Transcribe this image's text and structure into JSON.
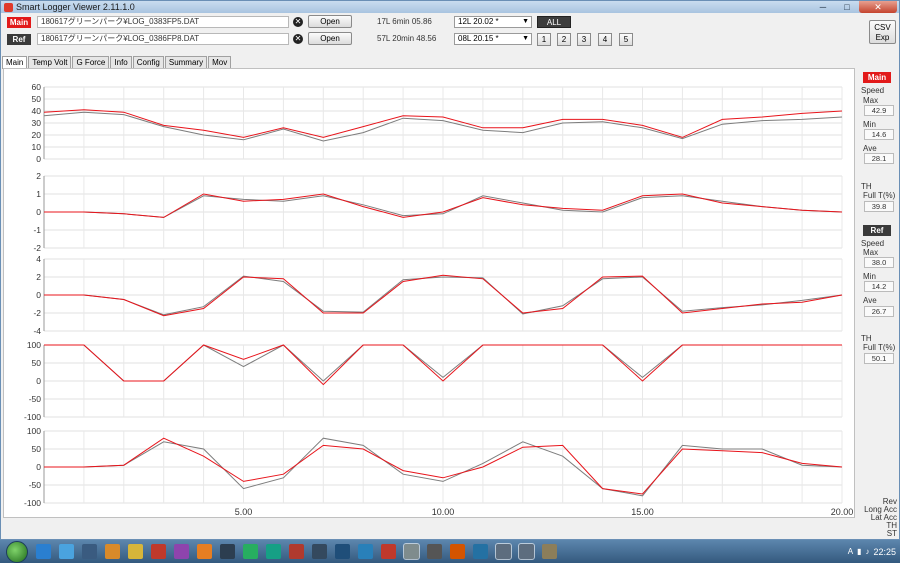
{
  "window": {
    "title": "Smart Logger Viewer 2.11.1.0",
    "minimize": "─",
    "maximize": "□",
    "close": "✕"
  },
  "files": {
    "main_tag": "Main",
    "ref_tag": "Ref",
    "main_file": "180617グリーンパーク¥LOG_0383FP5.DAT",
    "ref_file": "180617グリーンパーク¥LOG_0386FP8.DAT",
    "open_label": "Open",
    "main_laps": "17L 6min 05.86",
    "ref_laps": "57L 20min 48.56",
    "main_lap_select": "12L 20.02 *",
    "ref_lap_select": "08L 20.15 *",
    "all_label": "ALL",
    "num_buttons": [
      "1",
      "2",
      "3",
      "4",
      "5"
    ],
    "csv_line1": "CSV",
    "csv_line2": "Exp"
  },
  "tabs": [
    "Main",
    "Temp Volt",
    "G Force",
    "Info",
    "Config",
    "Summary",
    "Mov"
  ],
  "side_main": {
    "tag": "Main",
    "speed": "Speed",
    "max_label": "Max",
    "max": "42.9",
    "min_label": "Min",
    "min": "14.6",
    "ave_label": "Ave",
    "ave": "28.1",
    "th_label": "TH",
    "full_label": "Full T(%)",
    "full": "39.8"
  },
  "side_ref": {
    "tag": "Ref",
    "speed": "Speed",
    "max_label": "Max",
    "max": "38.0",
    "min_label": "Min",
    "min": "14.2",
    "ave_label": "Ave",
    "ave": "26.7",
    "th_label": "TH",
    "full_label": "Full T(%)",
    "full": "50.1"
  },
  "right_legend": [
    "Rev",
    "Long Acc",
    "Lat Acc",
    "TH",
    "ST"
  ],
  "colors": {
    "main_series": "#e8141b",
    "ref_series": "#7d7d7d"
  },
  "chart_data": [
    {
      "type": "line",
      "ylim": [
        0,
        60
      ],
      "yticks": [
        "60",
        "50",
        "40",
        "30",
        "20",
        "10",
        "0"
      ],
      "x": [
        0,
        1,
        2,
        3,
        4,
        5,
        6,
        7,
        8,
        9,
        10,
        11,
        12,
        13,
        14,
        15,
        16,
        17,
        18,
        19,
        20
      ],
      "series": [
        {
          "values": [
            39,
            41,
            39,
            28,
            24,
            18,
            26,
            18,
            27,
            36,
            35,
            26,
            26,
            33,
            33,
            28,
            18,
            33,
            35,
            38,
            40
          ]
        },
        {
          "values": [
            36,
            39,
            37,
            27,
            20,
            16,
            25,
            15,
            22,
            34,
            32,
            24,
            22,
            30,
            31,
            26,
            17,
            29,
            32,
            33,
            35
          ]
        }
      ]
    },
    {
      "type": "line",
      "ylim": [
        -2,
        2
      ],
      "yticks": [
        "2",
        "1",
        "0",
        "-1",
        "-2"
      ],
      "x": [
        0,
        1,
        2,
        3,
        4,
        5,
        6,
        7,
        8,
        9,
        10,
        11,
        12,
        13,
        14,
        15,
        16,
        17,
        18,
        19,
        20
      ],
      "series": [
        {
          "values": [
            0,
            0,
            -0.1,
            -0.3,
            1.0,
            0.6,
            0.7,
            1.0,
            0.3,
            -0.3,
            0,
            0.8,
            0.4,
            0.2,
            0.1,
            0.9,
            1.0,
            0.5,
            0.3,
            0.1,
            0
          ]
        },
        {
          "values": [
            0,
            0,
            -0.1,
            -0.3,
            0.9,
            0.7,
            0.6,
            0.9,
            0.4,
            -0.2,
            -0.1,
            0.9,
            0.5,
            0.1,
            0.0,
            0.8,
            0.9,
            0.6,
            0.3,
            0.1,
            0
          ]
        }
      ]
    },
    {
      "type": "line",
      "ylim": [
        -4,
        4
      ],
      "yticks": [
        "4",
        "2",
        "0",
        "-2",
        "-4"
      ],
      "x": [
        0,
        1,
        2,
        3,
        4,
        5,
        6,
        7,
        8,
        9,
        10,
        11,
        12,
        13,
        14,
        15,
        16,
        17,
        18,
        19,
        20
      ],
      "series": [
        {
          "values": [
            0,
            0,
            -0.5,
            -2.3,
            -1.5,
            2.0,
            1.8,
            -2.0,
            -2.0,
            1.5,
            2.2,
            1.8,
            -2.0,
            -1.5,
            2.0,
            2.1,
            -2.0,
            -1.5,
            -1.0,
            -0.8,
            0
          ]
        },
        {
          "values": [
            0,
            0,
            -0.5,
            -2.2,
            -1.3,
            2.1,
            1.5,
            -1.8,
            -1.9,
            1.7,
            2.0,
            1.9,
            -2.1,
            -1.2,
            1.8,
            2.0,
            -1.8,
            -1.4,
            -1.1,
            -0.6,
            0
          ]
        }
      ]
    },
    {
      "type": "line",
      "ylim": [
        -100,
        100
      ],
      "yticks": [
        "100",
        "50",
        "0",
        "-50",
        "-100"
      ],
      "x": [
        0,
        1,
        2,
        3,
        4,
        5,
        6,
        7,
        8,
        9,
        10,
        11,
        12,
        13,
        14,
        15,
        16,
        17,
        18,
        19,
        20
      ],
      "series": [
        {
          "values": [
            100,
            100,
            0,
            0,
            100,
            60,
            100,
            -10,
            100,
            100,
            0,
            100,
            100,
            100,
            100,
            0,
            100,
            100,
            100,
            100,
            100
          ]
        },
        {
          "values": [
            100,
            100,
            0,
            0,
            100,
            40,
            100,
            0,
            100,
            100,
            10,
            100,
            100,
            100,
            100,
            10,
            100,
            100,
            100,
            100,
            100
          ]
        }
      ]
    },
    {
      "type": "line",
      "ylim": [
        -100,
        100
      ],
      "yticks": [
        "100",
        "50",
        "0",
        "-50",
        "-100"
      ],
      "xticks": [
        "5.00",
        "10.00",
        "15.00",
        "20.00"
      ],
      "x": [
        0,
        1,
        2,
        3,
        4,
        5,
        6,
        7,
        8,
        9,
        10,
        11,
        12,
        13,
        14,
        15,
        16,
        17,
        18,
        19,
        20
      ],
      "series": [
        {
          "values": [
            0,
            0,
            5,
            80,
            30,
            -40,
            -20,
            60,
            50,
            -10,
            -30,
            0,
            55,
            60,
            -60,
            -75,
            50,
            45,
            40,
            10,
            0
          ]
        },
        {
          "values": [
            0,
            0,
            5,
            70,
            50,
            -60,
            -30,
            80,
            60,
            -20,
            -40,
            10,
            70,
            30,
            -60,
            -80,
            60,
            50,
            50,
            5,
            0
          ]
        }
      ]
    }
  ]
}
